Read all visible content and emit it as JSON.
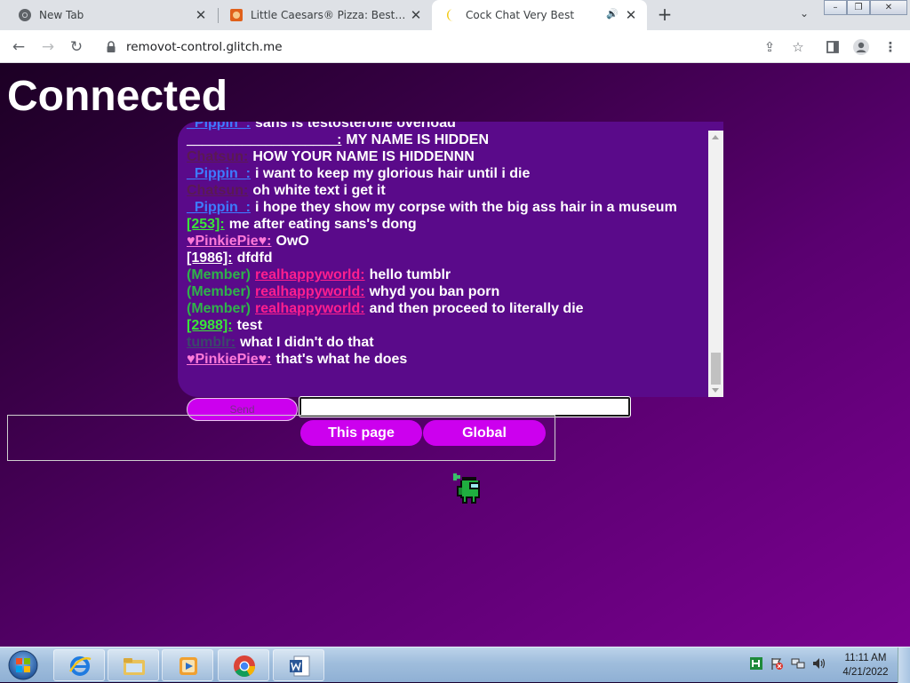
{
  "browser": {
    "tabs": [
      {
        "title": "New Tab",
        "active": false
      },
      {
        "title": "Little Caesars® Pizza: Best Value",
        "active": false
      },
      {
        "title": "Cock Chat Very Best",
        "active": true
      }
    ],
    "url": "removot-control.glitch.me",
    "audio_icon": "🔊"
  },
  "page": {
    "heading": "Connected",
    "chat": {
      "messages": [
        {
          "prefix": "",
          "user": "_Pippin_:",
          "user_color": "#3d7bff",
          "text": "sans is testosterone overload"
        },
        {
          "prefix": "",
          "user": "___________________:",
          "user_color": "#ffffff",
          "text": "MY NAME IS HIDDEN"
        },
        {
          "prefix": "",
          "user": "Chatsun:",
          "user_color": "#5a1a52",
          "text": "HOW YOUR NAME IS HIDDENNN"
        },
        {
          "prefix": "",
          "user": "_Pippin_:",
          "user_color": "#3d7bff",
          "text": "i want to keep my glorious hair until i die"
        },
        {
          "prefix": "",
          "user": "Chatsun:",
          "user_color": "#5a1a52",
          "text": "oh white text i get it"
        },
        {
          "prefix": "",
          "user": "_Pippin_:",
          "user_color": "#3d7bff",
          "text": "i hope they show my corpse with the big ass hair in a museum"
        },
        {
          "prefix": "",
          "user": "[253]:",
          "user_color": "#39e639",
          "text": "me after eating sans's dong"
        },
        {
          "prefix": "",
          "user": "♥PinkiePie♥:",
          "user_color": "#ff7ad9",
          "text": "OwO"
        },
        {
          "prefix": "",
          "user": "[1986]:",
          "user_color": "#ffffff",
          "text": "dfdfd"
        },
        {
          "prefix": "(Member)",
          "user": "realhappyworld:",
          "user_color": "#ff1f8e",
          "text": "hello tumblr"
        },
        {
          "prefix": "(Member)",
          "user": "realhappyworld:",
          "user_color": "#ff1f8e",
          "text": "whyd you ban porn"
        },
        {
          "prefix": "(Member)",
          "user": "realhappyworld:",
          "user_color": "#ff1f8e",
          "text": "and then proceed to literally die"
        },
        {
          "prefix": "",
          "user": "[2988]:",
          "user_color": "#39e639",
          "text": "test"
        },
        {
          "prefix": "",
          "user": "tumblr:",
          "user_color": "#3a4a6a",
          "text": "what I didn't do that"
        },
        {
          "prefix": "",
          "user": "♥PinkiePie♥:",
          "user_color": "#ff7ad9",
          "text": "that's what he does"
        }
      ],
      "send_label": "Send",
      "input_value": "",
      "input_placeholder": ""
    },
    "tab_buttons": [
      "This page",
      "Global"
    ]
  },
  "taskbar": {
    "clock_time": "11:11 AM",
    "clock_date": "4/21/2022"
  }
}
